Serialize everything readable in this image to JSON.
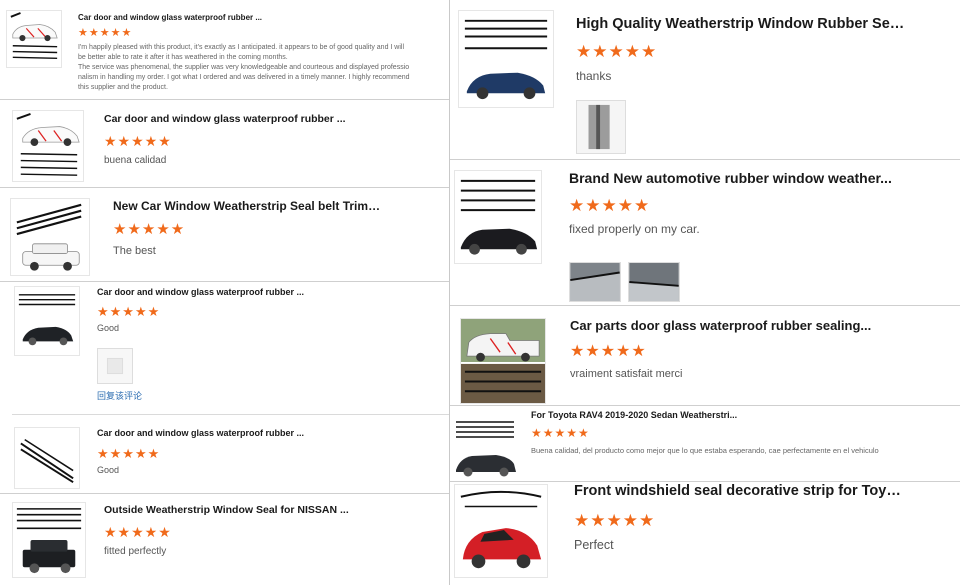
{
  "colors": {
    "star": "#f06a1b",
    "divider": "#cfcfcf",
    "title": "#1a1a1a",
    "text": "#555555"
  },
  "left": [
    {
      "title": "Car door and window glass waterproof rubber ...",
      "stars": "★★★★★",
      "rating": 5,
      "review": [
        "I'm happily pleased with this product, it's exactly as I anticipated. it appears to be of good quality and I will",
        "be better able to rate it  after it has weathered in the coming months.",
        "The service was phenomenal, the supplier was very knowledgeable and courteous and displayed professio",
        "nalism in handling my order. I got what I ordered and was delivered in a timely manner. I highly recommend",
        "this supplier and the product."
      ],
      "thumb_icon": "white-car-with-seal-strips-icon"
    },
    {
      "title": "Car door and window glass waterproof rubber ...",
      "stars": "★★★★★",
      "rating": 5,
      "review": "buena calidad",
      "thumb_icon": "white-car-with-seal-strips-icon"
    },
    {
      "title": "New Car Window Weatherstrip Seal belt Trim S...",
      "stars": "★★★★★",
      "rating": 5,
      "review": "The best",
      "thumb_icon": "white-suv-with-seal-strips-icon"
    },
    {
      "title": "Car door and window glass waterproof rubber ...",
      "stars": "★★★★★",
      "rating": 5,
      "review": "Good",
      "thumb_icon": "black-sedan-with-seal-strips-icon",
      "link": "回复该评论"
    },
    {
      "title": "Car door and window glass waterproof rubber ...",
      "stars": "★★★★★",
      "rating": 5,
      "review": "Good",
      "thumb_icon": "seal-strips-icon"
    },
    {
      "title": "Outside Weatherstrip Window Seal for NISSAN ...",
      "stars": "★★★★★",
      "rating": 5,
      "review": "fitted perfectly",
      "thumb_icon": "black-suv-with-seal-strips-icon"
    }
  ],
  "right": [
    {
      "title": "High Quality Weatherstrip Window Rubber Seal...",
      "stars": "★★★★★",
      "rating": 5,
      "review": "thanks",
      "thumb_icon": "blue-sedan-with-seal-strips-icon"
    },
    {
      "title": "Brand New automotive rubber window weather...",
      "stars": "★★★★★",
      "rating": 5,
      "review": "fixed properly on my car.",
      "thumb_icon": "dark-sedan-with-seal-strips-icon"
    },
    {
      "title": "Car parts door glass waterproof rubber sealing...",
      "stars": "★★★★★",
      "rating": 5,
      "review": "vraiment satisfait merci",
      "thumb_icon": "white-pickup-with-seal-strips-icon"
    },
    {
      "title": "For Toyota RAV4 2019-2020 Sedan Weatherstri...",
      "stars": "★★★★★",
      "rating": 5,
      "review": "Buena calidad, del producto como mejor que lo que estaba esperando, cae perfectamente en el vehiculo",
      "thumb_icon": "dark-suv-with-seal-strips-icon"
    },
    {
      "title": "Front windshield seal decorative strip for Toyot...",
      "stars": "★★★★★",
      "rating": 5,
      "review": "Perfect",
      "thumb_icon": "red-hatchback-with-seal-strips-icon"
    }
  ]
}
